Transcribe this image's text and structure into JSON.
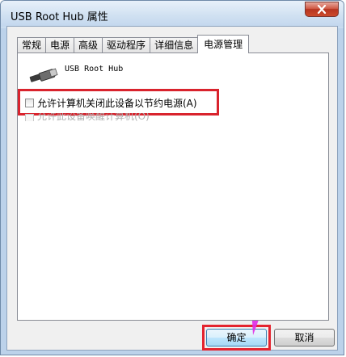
{
  "window": {
    "title": "USB Root Hub 属性",
    "close_label": "×"
  },
  "tabs": [
    {
      "label": "常规",
      "active": false
    },
    {
      "label": "电源",
      "active": false
    },
    {
      "label": "高级",
      "active": false
    },
    {
      "label": "驱动程序",
      "active": false
    },
    {
      "label": "详细信息",
      "active": false
    },
    {
      "label": "电源管理",
      "active": true
    }
  ],
  "device": {
    "name": "USB Root Hub",
    "icon": "usb-plug-icon"
  },
  "options": [
    {
      "label": "允许计算机关闭此设备以节约电源(A)",
      "checked": false,
      "enabled": true
    },
    {
      "label": "允许此设备唤醒计算机(O)",
      "checked": false,
      "enabled": false
    }
  ],
  "buttons": {
    "ok": "确定",
    "cancel": "取消"
  },
  "annotations": {
    "highlight_color": "#d9232d",
    "arrow_color": "#e12fe6"
  }
}
